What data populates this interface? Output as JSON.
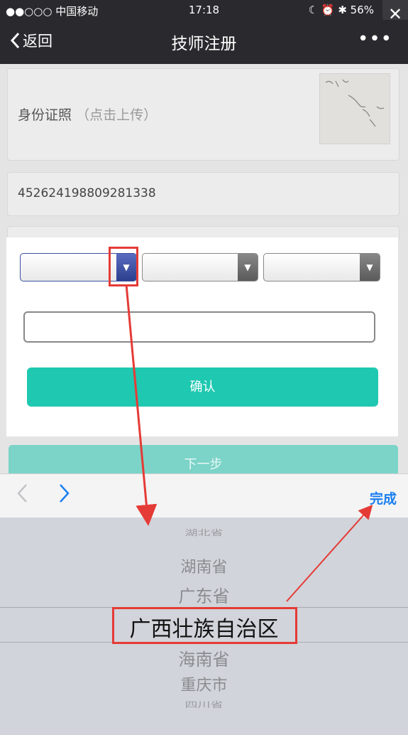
{
  "status_bar": {
    "carrier": "●●○○○ 中国移动",
    "time": "17:18",
    "battery": "56%"
  },
  "nav": {
    "back_label": "返回",
    "title": "技师注册",
    "more": "•••"
  },
  "form": {
    "id_photo_label": "身份证照",
    "id_photo_hint": "（点击上传）",
    "id_number": "452624198809281338",
    "confirm_label": "确认",
    "next_label": "下一步"
  },
  "picker": {
    "done_label": "完成",
    "items": [
      "湖北省",
      "湖南省",
      "广东省",
      "广西壮族自治区",
      "海南省",
      "重庆市",
      "四川省"
    ],
    "selected": "广西壮族自治区"
  },
  "colors": {
    "accent": "#1fc8b1",
    "ios_blue": "#1a7ff0",
    "highlight_red": "#e53b36"
  }
}
